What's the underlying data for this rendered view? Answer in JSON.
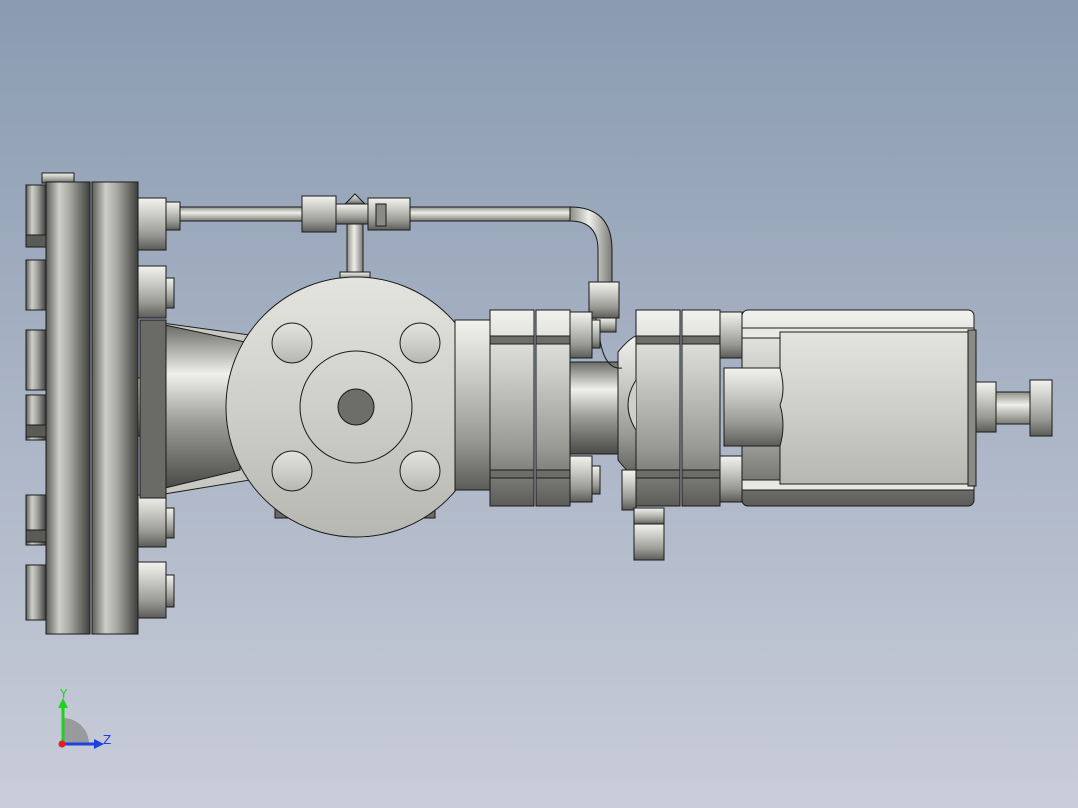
{
  "viewport": {
    "background_top": "#8a9bb1",
    "background_bottom": "#c9cdd9"
  },
  "triad": {
    "y_label": "Y",
    "z_label": "Z",
    "y_color": "#1fd21f",
    "z_color": "#1f3fe0",
    "x_color": "#e01f1f"
  },
  "model": {
    "metal_light": "#d8d8d4",
    "metal_dark": "#4a4a48",
    "edge": "#1a1a1a"
  }
}
